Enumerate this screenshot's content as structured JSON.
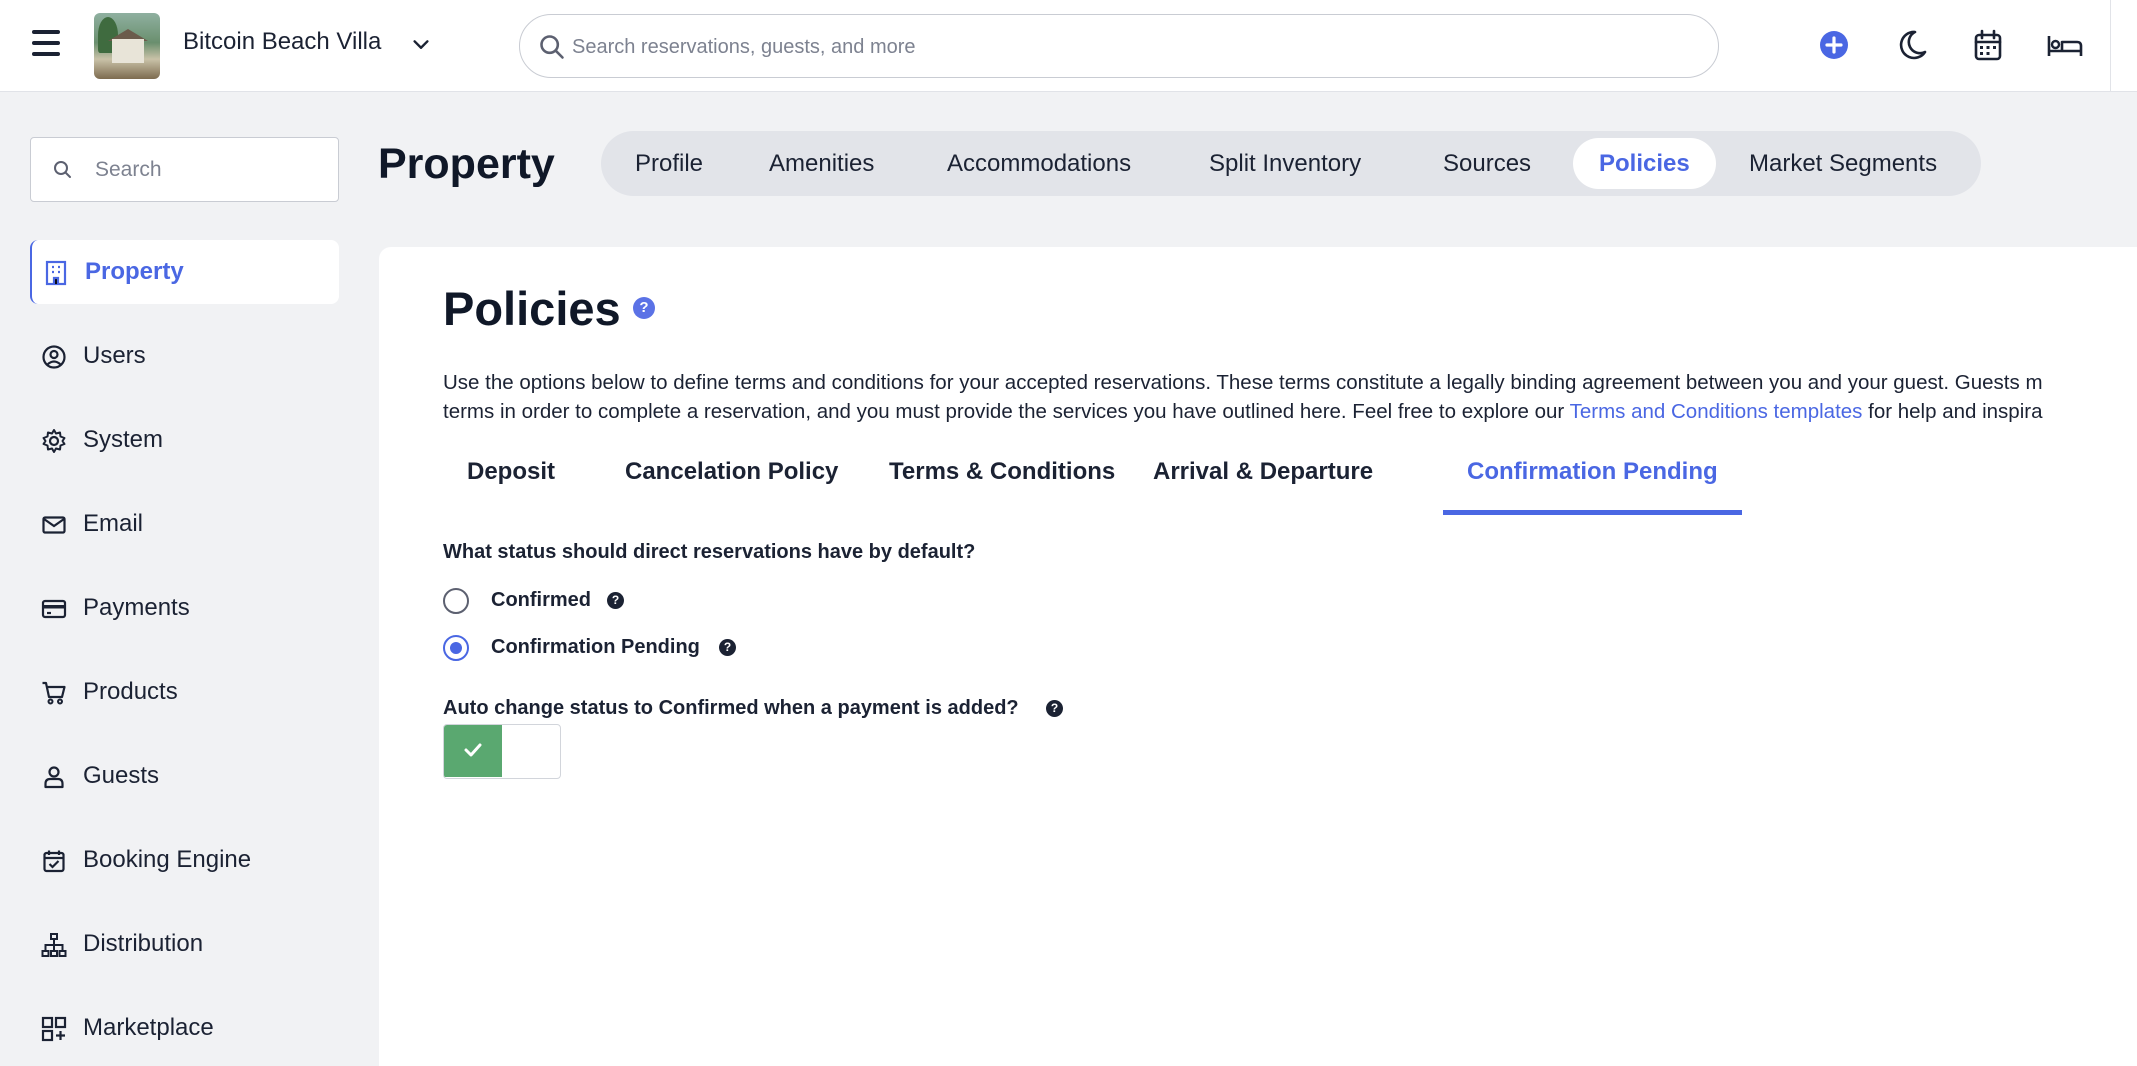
{
  "topbar": {
    "property_name": "Bitcoin Beach Villa",
    "search_placeholder": "Search reservations, guests, and more",
    "icons": [
      "menu-icon",
      "chevron-down-icon",
      "search-icon",
      "plus-circle-icon",
      "moon-icon",
      "calendar-icon",
      "bed-icon"
    ]
  },
  "sidebar": {
    "search_placeholder": "Search",
    "items": [
      {
        "label": "Property",
        "icon": "building-icon",
        "active": true
      },
      {
        "label": "Users",
        "icon": "user-circle-icon"
      },
      {
        "label": "System",
        "icon": "gear-icon"
      },
      {
        "label": "Email",
        "icon": "envelope-icon"
      },
      {
        "label": "Payments",
        "icon": "credit-card-icon"
      },
      {
        "label": "Products",
        "icon": "cart-icon"
      },
      {
        "label": "Guests",
        "icon": "person-icon"
      },
      {
        "label": "Booking Engine",
        "icon": "calendar-check-icon"
      },
      {
        "label": "Distribution",
        "icon": "sitemap-icon"
      },
      {
        "label": "Marketplace",
        "icon": "grid-plus-icon"
      }
    ]
  },
  "header": {
    "title": "Property",
    "tabs": [
      {
        "label": "Profile"
      },
      {
        "label": "Amenities"
      },
      {
        "label": "Accommodations"
      },
      {
        "label": "Split Inventory"
      },
      {
        "label": "Sources"
      },
      {
        "label": "Policies",
        "active": true
      },
      {
        "label": "Market Segments"
      }
    ]
  },
  "main": {
    "title": "Policies",
    "help_glyph": "?",
    "description_line1": "Use the options below to define terms and conditions for your accepted reservations. These terms constitute a legally binding agreement between you and your guest. Guests m",
    "description_line2_before": "terms in order to complete a reservation, and you must provide the services you have outlined here. Feel free to explore our ",
    "description_link": "Terms and Conditions templates",
    "description_line2_after": " for help and inspira",
    "policy_tabs": [
      {
        "label": "Deposit"
      },
      {
        "label": "Cancelation Policy"
      },
      {
        "label": "Terms & Conditions"
      },
      {
        "label": "Arrival & Departure"
      },
      {
        "label": "Confirmation Pending",
        "active": true
      }
    ],
    "default_status_question": "What status should direct reservations have by default?",
    "status_options": [
      {
        "label": "Confirmed",
        "selected": false
      },
      {
        "label": "Confirmation Pending",
        "selected": true
      }
    ],
    "auto_change_question": "Auto change status to Confirmed when a payment is added?",
    "auto_change_enabled": true
  },
  "colors": {
    "accent": "#4a67e3",
    "toggle_on": "#5aa870",
    "background": "#f1f2f4"
  }
}
